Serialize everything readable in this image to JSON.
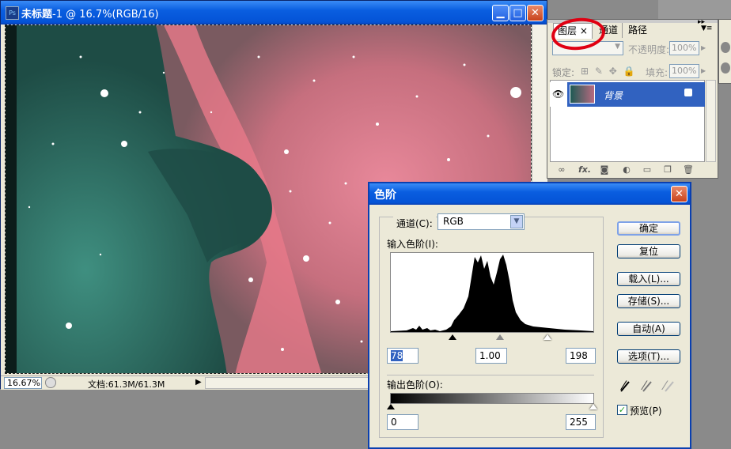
{
  "document": {
    "title": "未标题",
    "title_suffix": "-1 @ 16.7%(RGB/16)",
    "zoom": "16.67%",
    "doc_info": "文档:61.3M/61.3M"
  },
  "layers_panel": {
    "tabs": [
      "图层",
      "通道",
      "路径"
    ],
    "tab_close": "×",
    "opacity_label": "不透明度:",
    "opacity_value": "100%",
    "lock_label": "锁定:",
    "fill_label": "填充:",
    "fill_value": "100%",
    "layer_name": "背景",
    "fx_label": "fx."
  },
  "levels_dialog": {
    "title": "色阶",
    "channel_label": "通道(C):",
    "channel_value": "RGB",
    "input_label": "输入色阶(I):",
    "output_label": "输出色阶(O):",
    "input_black": "78",
    "input_gamma": "1.00",
    "input_white": "198",
    "output_black": "0",
    "output_white": "255",
    "buttons": {
      "ok": "确定",
      "reset": "复位",
      "load": "载入(L)...",
      "save": "存储(S)...",
      "auto": "自动(A)",
      "options": "选项(T)..."
    },
    "preview_label": "预览(P)",
    "preview_checked": true
  },
  "colors": {
    "titlebar": "#0453d6",
    "selected_layer": "#3162c0",
    "annotation": "#e00012"
  }
}
